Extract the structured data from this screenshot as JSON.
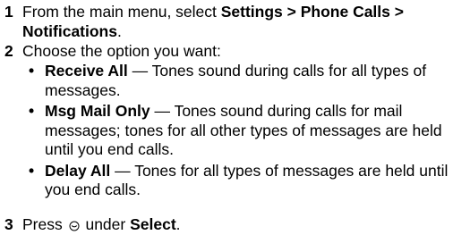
{
  "steps": [
    {
      "number": "1",
      "text_before": "From the main menu, select ",
      "bold": "Settings > Phone Calls > Notifications",
      "text_after": "."
    },
    {
      "number": "2",
      "text": "Choose the option you want:",
      "options": [
        {
          "name": "Receive All",
          "description": " — Tones sound during calls for all types of messages."
        },
        {
          "name": "Msg Mail Only",
          "description": " — Tones sound during calls for mail messages; tones for all other types of messages are held until you end calls."
        },
        {
          "name": "Delay All",
          "description": " — Tones for all types of messages are held until you end calls."
        }
      ]
    },
    {
      "number": "3",
      "text_before": "Press ",
      "icon": "left-softkey-icon",
      "text_middle": " under ",
      "bold": "Select",
      "text_after": "."
    }
  ],
  "bullet_glyph": "•"
}
